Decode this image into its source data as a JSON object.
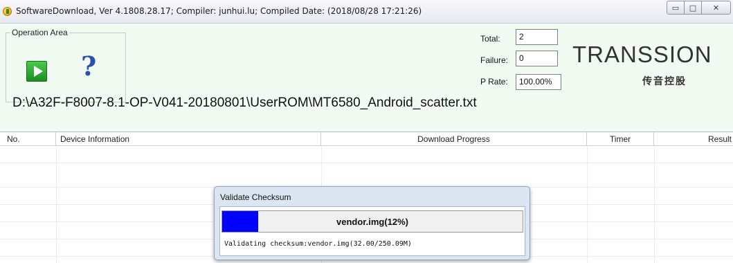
{
  "window": {
    "title": "SoftwareDownload, Ver 4.1808.28.17; Compiler: junhui.lu; Compiled Date: (2018/08/28 17:21:26)",
    "buttons": {
      "minimize": "▭",
      "maximize": "□",
      "close": "✕"
    }
  },
  "operation_area": {
    "label": "Operation Area",
    "start_icon": "play-icon",
    "help_icon": "help-icon",
    "help_glyph": "?"
  },
  "stats": {
    "total_label": "Total:",
    "total_value": "2",
    "failure_label": "Failure:",
    "failure_value": "0",
    "prate_label": "P Rate:",
    "prate_value": "100.00%"
  },
  "logo": {
    "main": "TRANSSION",
    "sub": "传音控股"
  },
  "scatter_file": "D:\\A32F-F8007-8.1-OP-V041-20180801\\UserROM\\MT6580_Android_scatter.txt",
  "table": {
    "columns": [
      "No.",
      "Device Information",
      "Download Progress",
      "Timer",
      "Result"
    ]
  },
  "dialog": {
    "title": "Validate Checksum",
    "progress_fraction": 0.12,
    "progress_label": "vendor.img(12%)",
    "status": "Validating checksum:vendor.img(32.00/250.09M)"
  },
  "colors": {
    "background": "#f2fbf2",
    "progress_fill": "#0000ff"
  }
}
